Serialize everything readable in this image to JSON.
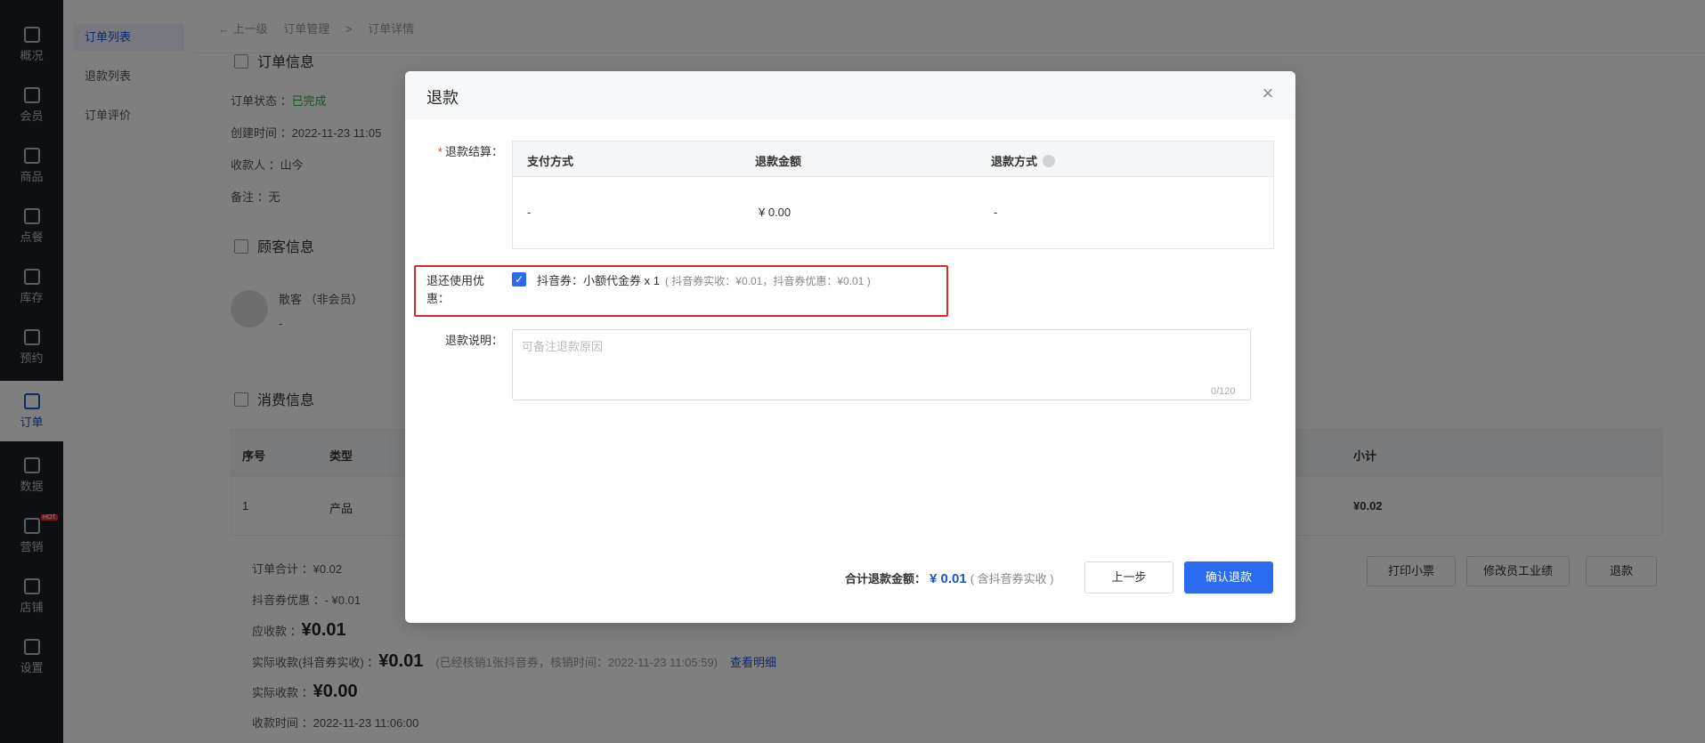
{
  "rail": {
    "items": [
      {
        "label": "概况"
      },
      {
        "label": "会员"
      },
      {
        "label": "商品"
      },
      {
        "label": "点餐"
      },
      {
        "label": "库存"
      },
      {
        "label": "预约"
      },
      {
        "label": "订单"
      },
      {
        "label": "数据"
      },
      {
        "label": "营销",
        "badge": "HOT"
      },
      {
        "label": "店铺"
      },
      {
        "label": "设置"
      }
    ]
  },
  "subnav": {
    "items": [
      {
        "label": "订单列表"
      },
      {
        "label": "退款列表"
      },
      {
        "label": "订单评价"
      }
    ]
  },
  "breadcrumb": {
    "back": "← 上一级",
    "path1": "订单管理",
    "sep": ">",
    "path2": "订单详情"
  },
  "order_info": {
    "title": "订单信息",
    "status_label": "订单状态 ：",
    "status_value": "已完成",
    "created": "创建时间 ：2022-11-23 11:05",
    "receiver": "收款人 ：山今",
    "note": "备注 ：无"
  },
  "customer_info": {
    "title": "顾客信息",
    "name": "散客 （非会员）",
    "sub": "-"
  },
  "consume_info": {
    "title": "消费信息",
    "headers": {
      "index": "序号",
      "type": "类型",
      "subtotal": "小计"
    },
    "rows": [
      {
        "index": "1",
        "type": "产品",
        "subtotal": "¥0.02"
      }
    ]
  },
  "summary": {
    "order_total": "订单合计 ：¥0.02",
    "coupon_discount": "抖音券优惠 ：- ¥0.01",
    "receivable_label": "应收款 ：",
    "receivable_value": "¥0.01",
    "actual_coupon_label": "实际收款(抖音券实收) ：",
    "actual_coupon_value": "¥0.01",
    "actual_coupon_note": "(已经核销1张抖音券，核销时间：2022-11-23 11:05:59)",
    "view_detail": "查看明细",
    "actual_label": "实际收款 ：",
    "actual_value": "¥0.00",
    "pay_time": "收款时间 ：2022-11-23 11:06:00"
  },
  "page_actions": {
    "print": "打印小票",
    "modify_staff": "修改员工业绩",
    "refund": "退款"
  },
  "modal": {
    "title": "退款",
    "settle_label": "退款结算：",
    "table": {
      "headers": {
        "pay_method": "支付方式",
        "refund_amount": "退款金额",
        "refund_way": "退款方式"
      },
      "row": {
        "pay_method": "-",
        "refund_amount": "¥ 0.00",
        "refund_way": "-"
      }
    },
    "coupon_label": "退还使用优惠：",
    "coupon_text": "抖音券：小额代金券 x 1",
    "coupon_note": "( 抖音券实收：¥0.01，抖音券优惠：¥0.01 )",
    "coupon_checked": true,
    "reason_label": "退款说明：",
    "reason_placeholder": "可备注退款原因",
    "reason_counter": "0/120",
    "total_label": "合计退款金额：",
    "total_value": "¥ 0.01",
    "total_note": "( 含抖音券实收 )",
    "prev_button": "上一步",
    "confirm_button": "确认退款"
  },
  "colors": {
    "accent": "#2a6bef",
    "highlight_border": "#d9292b",
    "success": "#2fa44f"
  }
}
